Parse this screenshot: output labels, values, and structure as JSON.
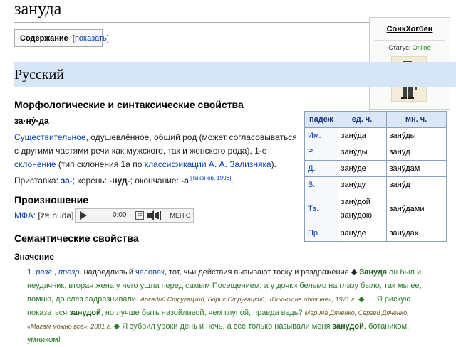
{
  "page": {
    "title": "зануда"
  },
  "toc": {
    "label": "Содержание",
    "bracket_open": "[",
    "show_link": "показать",
    "bracket_close": "]"
  },
  "user_box": {
    "name": "СонкХогбен",
    "status_label": "Статус: ",
    "status_value": "Online",
    "status_color": "#0a8a0a"
  },
  "language": {
    "title": "Русский"
  },
  "morph": {
    "heading": "Морфологические и синтаксические свойства",
    "stress": "за·ну́·да",
    "desc": [
      {
        "t": "Существительное",
        "link": true
      },
      {
        "t": ", одушевлённое, общий род (может согласовываться с другими частями речи как мужского, так и женского рода), 1-е ",
        "link": false
      },
      {
        "t": "склонение",
        "link": true
      },
      {
        "t": " (тип склонения 1a по ",
        "link": false
      },
      {
        "t": "классификации А. А. Зализняка",
        "link": true
      },
      {
        "t": ").",
        "link": false
      }
    ],
    "morphemes": [
      {
        "t": "Приставка: ",
        "style": "n"
      },
      {
        "t": "за-",
        "style": "b"
      },
      {
        "t": "; корень: ",
        "style": "n"
      },
      {
        "t": "-нуд-",
        "style": "b"
      },
      {
        "t": "; окончание: ",
        "style": "n"
      },
      {
        "t": "-а",
        "style": "b"
      },
      {
        "t": " [Тихонов, 1996]",
        "style": "sup"
      },
      {
        "t": ".",
        "style": "n"
      }
    ]
  },
  "declension": {
    "headers": [
      "падеж",
      "ед. ч.",
      "мн. ч."
    ],
    "rows": [
      [
        "Им.",
        "зану́да",
        "зану́ды"
      ],
      [
        "Р.",
        "зану́ды",
        "зану́д"
      ],
      [
        "Д.",
        "зану́де",
        "зану́дам"
      ],
      [
        "В.",
        "зану́ду",
        "зану́д"
      ],
      [
        "Тв.",
        "зану́дой\nзану́дою",
        "зану́дами"
      ],
      [
        "Пр.",
        "зану́де",
        "зану́дах"
      ]
    ]
  },
  "pronunciation": {
    "heading": "Произношение",
    "ipa_label": "МФА",
    "ipa_value": ": [zɐˈnudə]",
    "player": {
      "time": "0:00",
      "cc_label": "cc",
      "menu_label": "МЕНЮ"
    }
  },
  "semantics": {
    "heading": "Семантические свойства",
    "meaning_heading": "Значение",
    "item_number": "1.",
    "item": [
      {
        "t": "разг.",
        "s": "it-link"
      },
      {
        "t": ", ",
        "s": "n"
      },
      {
        "t": "презр.",
        "s": "it-link"
      },
      {
        "t": " надоедливый ",
        "s": "n"
      },
      {
        "t": "человек",
        "s": "link"
      },
      {
        "t": ", тот, чьи действия вызывают тоску и раздражение ◆ ",
        "s": "n"
      },
      {
        "t": "Зануда",
        "s": "bold-g"
      },
      {
        "t": " он был и неудачник, вторая жена у него ушла перед самым Посещением, а у дочки бельмо на глазу было, так мы ее, помню, до слез задразнивали. ",
        "s": "green"
      },
      {
        "t": "Аркадий Стругацкий, Борис Стругацкий, «Пикник на обочине», 1971 г.",
        "s": "author"
      },
      {
        "t": " ◆ … Я рискую показаться ",
        "s": "green"
      },
      {
        "t": "занудой",
        "s": "bold-g"
      },
      {
        "t": ", но лучше быть назойливой, чем глупой, правда ведь? ",
        "s": "green"
      },
      {
        "t": "Марина Дяченко, Сергей Дяченко, «Магам можно всё», 2001 г.",
        "s": "author"
      },
      {
        "t": " ◆ Я зубрил уроки день и ночь, а все только называли меня ",
        "s": "green"
      },
      {
        "t": "занудой",
        "s": "bold-g"
      },
      {
        "t": ", ботаником, умником!",
        "s": "green"
      }
    ]
  }
}
